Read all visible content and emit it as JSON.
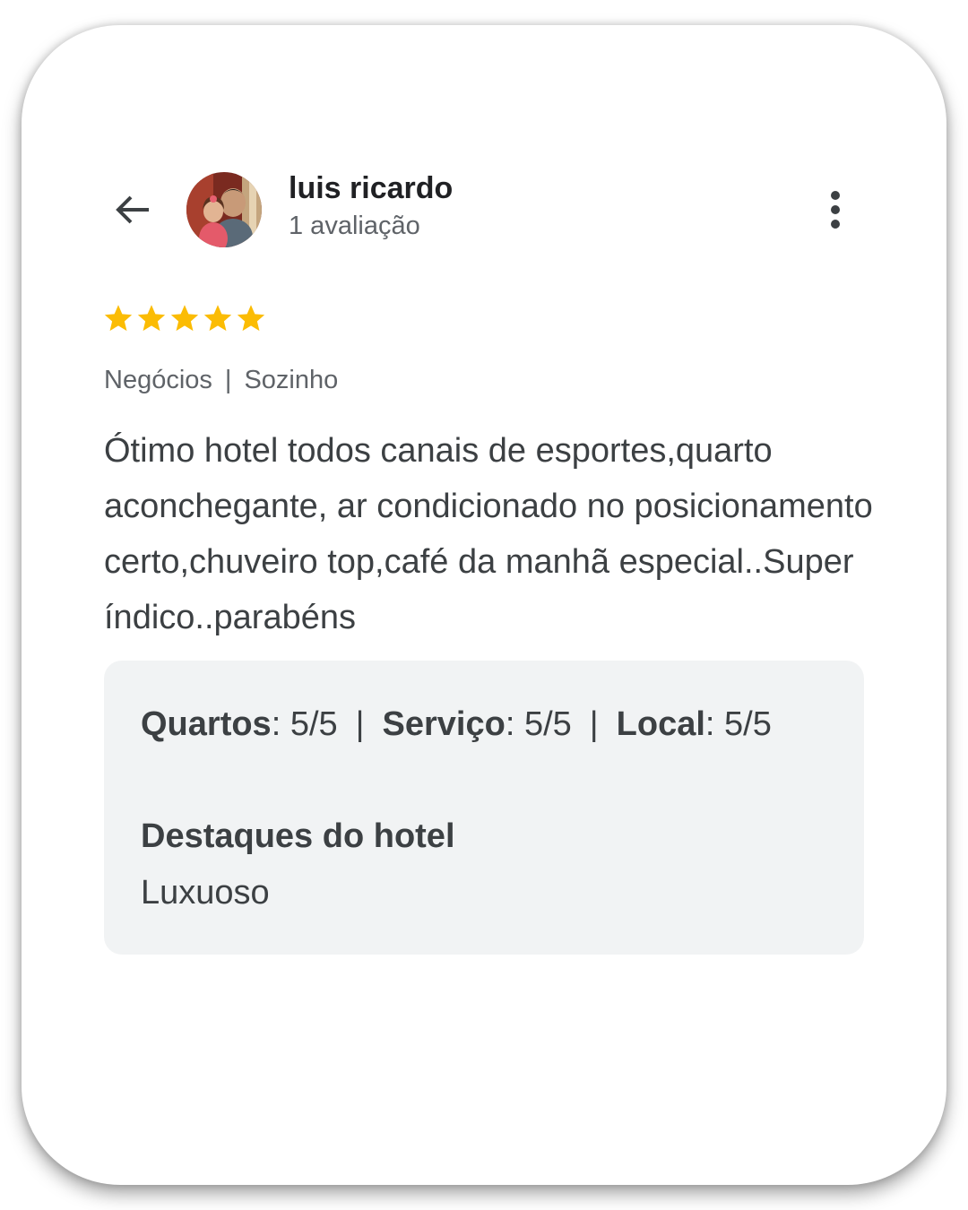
{
  "header": {
    "back_icon": "arrow-back-icon",
    "avatar_icon": "user-avatar-photo",
    "user_name": "luis ricardo",
    "review_count": "1 avaliação",
    "more_icon": "more-vert-icon"
  },
  "review": {
    "rating": 5,
    "rating_max": 5,
    "star_color": "#fbbc04",
    "trip_type": "Negócios",
    "trip_separator": "|",
    "companion": "Sozinho",
    "text": "Ótimo hotel todos canais de esportes,quarto aconchegante, ar condicionado no posicionamento certo,chuveiro top,café da manhã especial..Super índico..parabéns"
  },
  "details": {
    "ratings": [
      {
        "label": "Quartos",
        "colon": ":",
        "value": " 5/5"
      },
      {
        "label": "Serviço",
        "colon": ":",
        "value": " 5/5"
      },
      {
        "label": "Local",
        "colon": ":",
        "value": " 5/5"
      }
    ],
    "separator": "|",
    "highlights_title": "Destaques do hotel",
    "highlights_value": "Luxuoso"
  }
}
